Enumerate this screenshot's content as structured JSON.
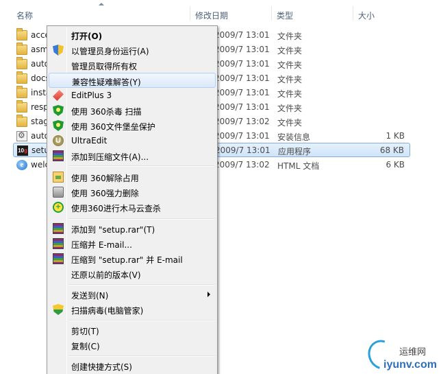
{
  "columns": {
    "name": "名称",
    "modified": "修改日期",
    "type": "类型",
    "size": "大小"
  },
  "files": [
    {
      "name": "accessories",
      "date": "2009/7 13:01",
      "type": "文件夹",
      "size": "",
      "icon": "folder-icon"
    },
    {
      "name": "asm",
      "date": "2009/7 13:01",
      "type": "文件夹",
      "size": "",
      "icon": "folder-icon"
    },
    {
      "name": "autorun",
      "date": "2009/7 13:01",
      "type": "文件夹",
      "size": "",
      "icon": "folder-icon"
    },
    {
      "name": "docs",
      "date": "2009/7 13:01",
      "type": "文件夹",
      "size": "",
      "icon": "folder-icon"
    },
    {
      "name": "install",
      "date": "2009/7 13:01",
      "type": "文件夹",
      "size": "",
      "icon": "folder-icon"
    },
    {
      "name": "resp",
      "date": "2009/7 13:01",
      "type": "文件夹",
      "size": "",
      "icon": "folder-icon"
    },
    {
      "name": "stage",
      "date": "2009/7 13:02",
      "type": "文件夹",
      "size": "",
      "icon": "folder-icon"
    },
    {
      "name": "autorun",
      "date": "2009/7 13:01",
      "type": "安装信息",
      "size": "1 KB",
      "icon": "settings-file-icon"
    },
    {
      "name": "setup",
      "date": "2009/7 13:01",
      "type": "应用程序",
      "size": "68 KB",
      "icon": "oracle-exe-icon"
    },
    {
      "name": "welcome",
      "date": "2009/7 13:02",
      "type": "HTML 文档",
      "size": "6 KB",
      "icon": "ie-html-icon"
    }
  ],
  "exe_icon_text": {
    "main": "10",
    "accent": "g"
  },
  "context_menu": {
    "open": "打开(O)",
    "run_as_admin": "以管理员身份运行(A)",
    "take_ownership": "管理员取得所有权",
    "troubleshoot_compat": "兼容性疑难解答(Y)",
    "editplus": "EditPlus 3",
    "scan_360": "使用 360杀毒 扫描",
    "protect_360": "使用 360文件堡垒保护",
    "ultraedit": "UltraEdit",
    "add_archive": "添加到压缩文件(A)...",
    "unlock_360": "使用 360解除占用",
    "force_delete_360": "使用 360强力删除",
    "trojan_cloud_360": "使用360进行木马云查杀",
    "add_to_rar": "添加到 \"setup.rar\"(T)",
    "compress_email": "压缩并 E-mail...",
    "compress_rar_email": "压缩到 \"setup.rar\" 并 E-mail",
    "restore_versions": "还原以前的版本(V)",
    "send_to": "发送到(N)",
    "scan_virus_pc_manager": "扫描病毒(电脑管家)",
    "cut": "剪切(T)",
    "copy": "复制(C)",
    "create_shortcut": "创建快捷方式(S)"
  },
  "icons": {
    "ultraedit_letter": "U",
    "cloud_scan_letter": "+"
  },
  "watermark": {
    "cn": "运维网",
    "en": "iyunv.com"
  }
}
